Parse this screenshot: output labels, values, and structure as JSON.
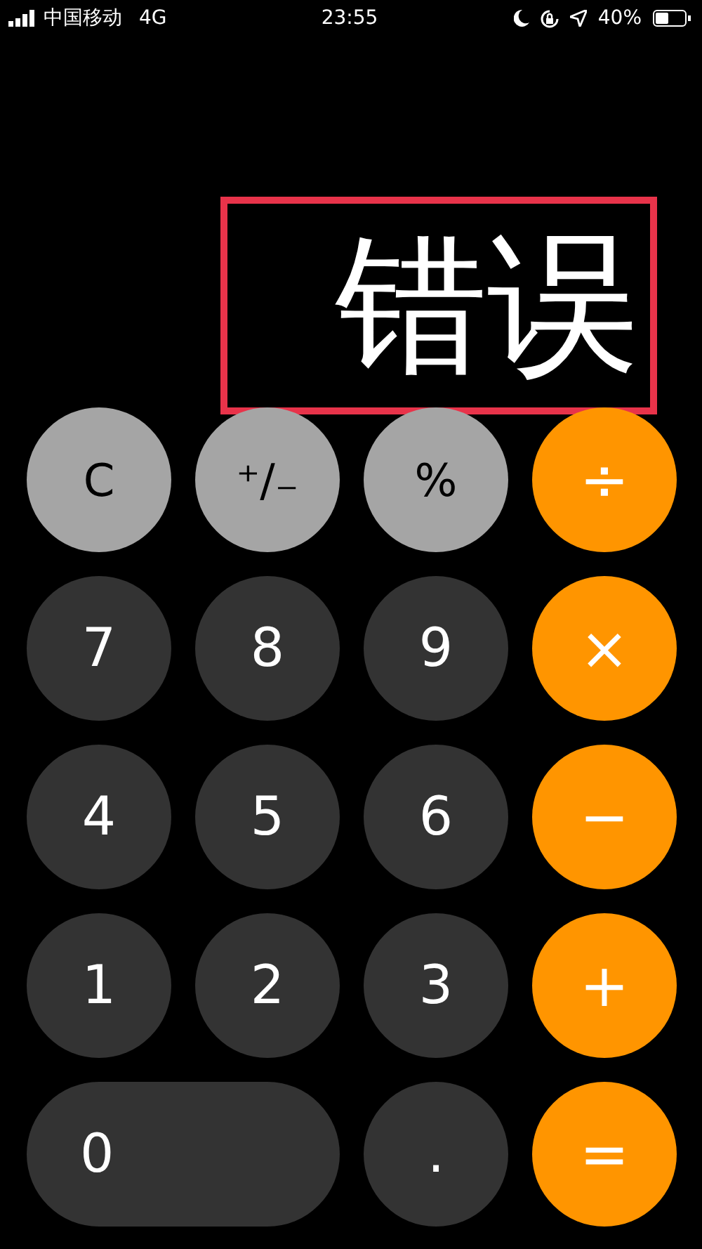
{
  "status_bar": {
    "carrier": "中国移动",
    "network": "4G",
    "time": "23:55",
    "battery": "40%"
  },
  "display": {
    "value": "错误",
    "highlighted": true
  },
  "keypad": [
    {
      "label": "C",
      "kind": "function"
    },
    {
      "label": "⁺∕₋",
      "kind": "function"
    },
    {
      "label": "%",
      "kind": "function"
    },
    {
      "label": "÷",
      "kind": "operator"
    },
    {
      "label": "7",
      "kind": "digit"
    },
    {
      "label": "8",
      "kind": "digit"
    },
    {
      "label": "9",
      "kind": "digit"
    },
    {
      "label": "×",
      "kind": "operator"
    },
    {
      "label": "4",
      "kind": "digit"
    },
    {
      "label": "5",
      "kind": "digit"
    },
    {
      "label": "6",
      "kind": "digit"
    },
    {
      "label": "−",
      "kind": "operator"
    },
    {
      "label": "1",
      "kind": "digit"
    },
    {
      "label": "2",
      "kind": "digit"
    },
    {
      "label": "3",
      "kind": "digit"
    },
    {
      "label": "+",
      "kind": "operator"
    },
    {
      "label": "0",
      "kind": "wide"
    },
    {
      "label": ".",
      "kind": "digit"
    },
    {
      "label": "=",
      "kind": "operator"
    }
  ]
}
